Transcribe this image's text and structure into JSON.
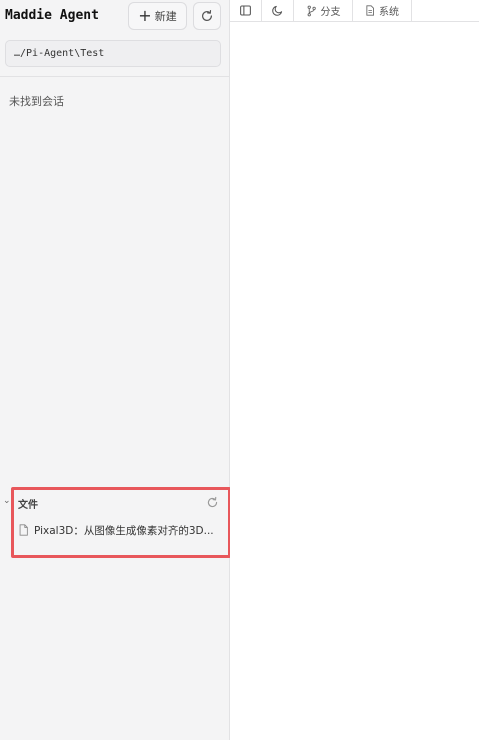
{
  "sidebar": {
    "app_title": "Maddie Agent",
    "new_button_label": "新建",
    "path": "…/Pi-Agent\\Test",
    "empty_message": "未找到会话",
    "files": {
      "header": "文件",
      "items": [
        {
          "name": "Pixal3D：从图像生成像素对齐的3D..."
        }
      ]
    }
  },
  "toolbar": {
    "branch_label": "分支",
    "system_label": "系统"
  },
  "colors": {
    "highlight": "#e8575b",
    "sidebar_bg": "#f4f4f5"
  },
  "icons": [
    "plus-icon",
    "refresh-icon",
    "sidebar-toggle-icon",
    "moon-icon",
    "git-branch-icon",
    "document-icon",
    "chevron-down-icon",
    "file-icon"
  ]
}
